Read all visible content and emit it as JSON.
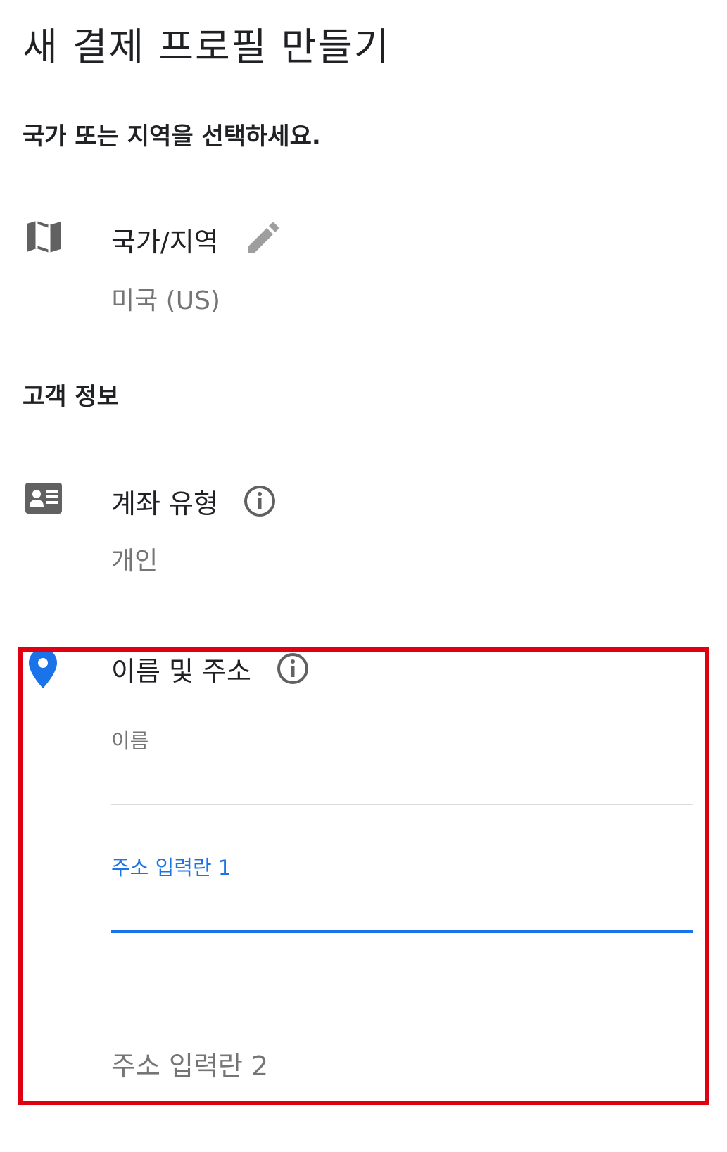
{
  "page": {
    "title": "새 결제 프로필 만들기",
    "country_prompt": "국가 또는 지역을 선택하세요."
  },
  "country": {
    "label": "국가/지역",
    "value": "미국 (US)",
    "icon": "map-icon",
    "edit_icon": "pencil-edit-icon"
  },
  "customer_info": {
    "heading": "고객 정보",
    "account_type": {
      "label": "계좌 유형",
      "value": "개인",
      "icon": "id-card-icon",
      "info_icon": "info-icon"
    },
    "name_address": {
      "label": "이름 및 주소",
      "icon": "location-pin-icon",
      "info_icon": "info-icon",
      "fields": {
        "name_label": "이름",
        "name_value": "",
        "address1_label": "주소 입력란 1",
        "address1_value": "",
        "address2_label": "주소 입력란 2"
      }
    }
  },
  "colors": {
    "accent_blue": "#1a73e8",
    "highlight_red": "#e00012",
    "icon_gray": "#616161",
    "secondary_text": "#757575"
  }
}
